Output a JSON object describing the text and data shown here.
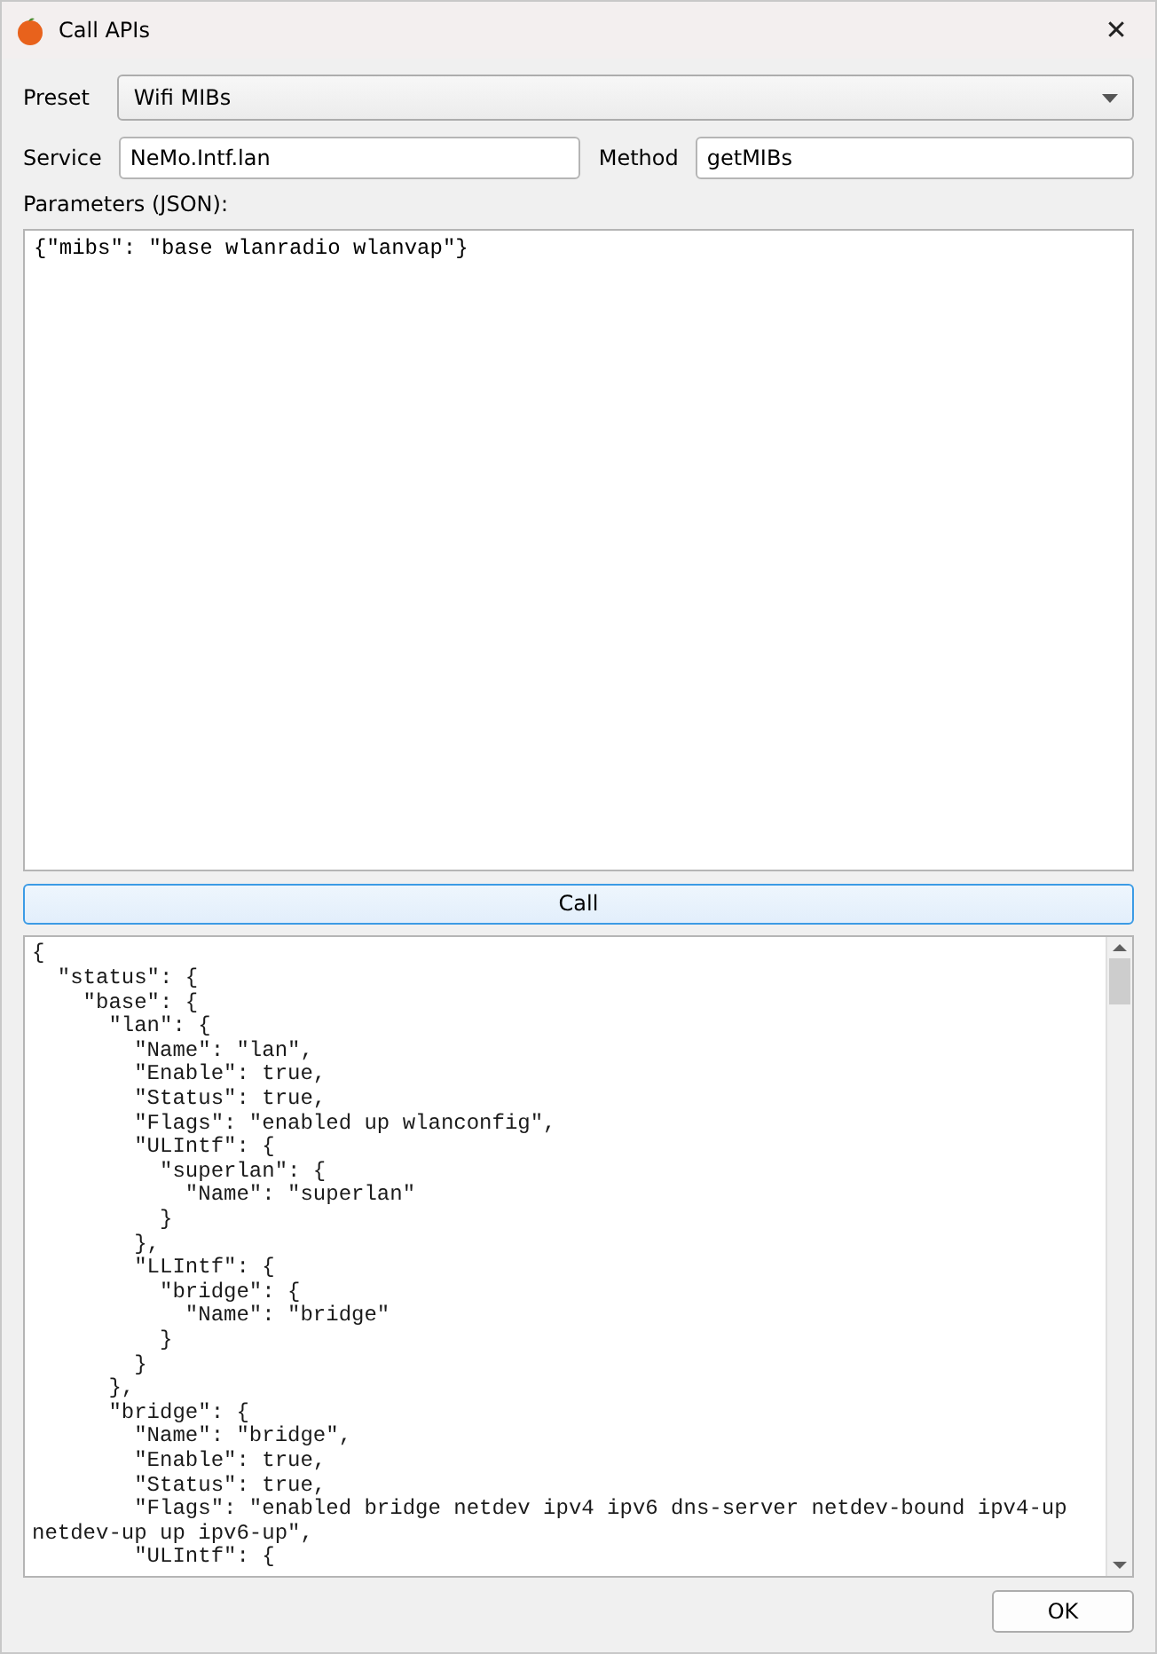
{
  "window": {
    "title": "Call APIs",
    "close": "✕"
  },
  "preset": {
    "label": "Preset",
    "value": "Wifi MIBs"
  },
  "service": {
    "label": "Service",
    "value": "NeMo.Intf.lan"
  },
  "method": {
    "label": "Method",
    "value": "getMIBs"
  },
  "parameters": {
    "label": "Parameters (JSON):",
    "value": "{\"mibs\": \"base wlanradio wlanvap\"}"
  },
  "call_button": "Call",
  "output_lines": [
    "{",
    "  \"status\": {",
    "    \"base\": {",
    "      \"lan\": {",
    "        \"Name\": \"lan\",",
    "        \"Enable\": true,",
    "        \"Status\": true,",
    "        \"Flags\": \"enabled up wlanconfig\",",
    "        \"ULIntf\": {",
    "          \"superlan\": {",
    "            \"Name\": \"superlan\"",
    "          }",
    "        },",
    "        \"LLIntf\": {",
    "          \"bridge\": {",
    "            \"Name\": \"bridge\"",
    "          }",
    "        }",
    "      },",
    "      \"bridge\": {",
    "        \"Name\": \"bridge\",",
    "        \"Enable\": true,",
    "        \"Status\": true,",
    "        \"Flags\": \"enabled bridge netdev ipv4 ipv6 dns-server netdev-bound ipv4-up",
    "netdev-up up ipv6-up\",",
    "        \"ULIntf\": {"
  ],
  "ok_button": "OK"
}
